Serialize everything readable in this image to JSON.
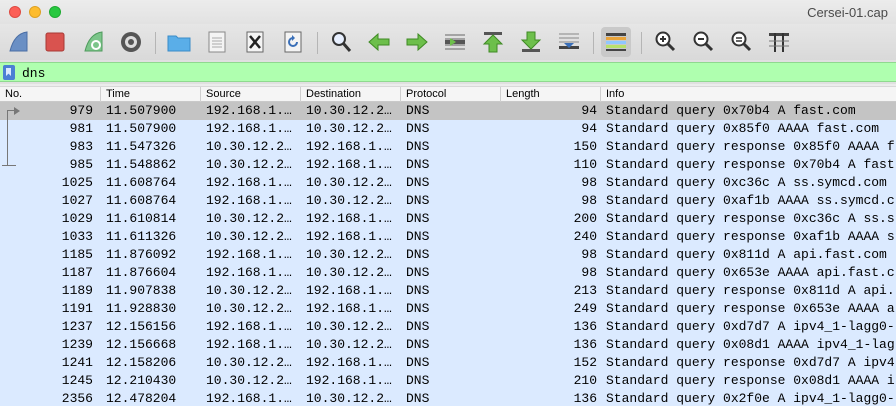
{
  "window": {
    "title": "Cersei-01.cap"
  },
  "toolbar": {
    "buttons": [
      {
        "name": "start-capture-icon"
      },
      {
        "name": "stop-capture-icon"
      },
      {
        "name": "restart-capture-icon"
      },
      {
        "name": "capture-options-icon"
      },
      {
        "name": "open-file-icon"
      },
      {
        "name": "save-file-icon"
      },
      {
        "name": "close-file-icon"
      },
      {
        "name": "reload-file-icon"
      },
      {
        "name": "find-packet-icon"
      },
      {
        "name": "go-back-icon"
      },
      {
        "name": "go-forward-icon"
      },
      {
        "name": "go-to-packet-icon"
      },
      {
        "name": "go-first-packet-icon"
      },
      {
        "name": "go-last-packet-icon"
      },
      {
        "name": "autoscroll-icon"
      },
      {
        "name": "colorize-icon"
      },
      {
        "name": "zoom-in-icon"
      },
      {
        "name": "zoom-out-icon"
      },
      {
        "name": "normal-size-icon"
      },
      {
        "name": "resize-columns-icon"
      }
    ]
  },
  "filter": {
    "value": "dns"
  },
  "columns": {
    "no": "No.",
    "time": "Time",
    "source": "Source",
    "destination": "Destination",
    "protocol": "Protocol",
    "length": "Length",
    "info": "Info"
  },
  "colors": {
    "filter_valid": "#afffaf",
    "row_udp": "#dbeaff",
    "row_selected": "#c4c4c4"
  },
  "packets": [
    {
      "no": "979",
      "time": "11.507900",
      "src": "192.168.1.…",
      "dst": "10.30.12.2…",
      "proto": "DNS",
      "len": "94",
      "info": "Standard query 0x70b4 A fast.com"
    },
    {
      "no": "981",
      "time": "11.507900",
      "src": "192.168.1.…",
      "dst": "10.30.12.2…",
      "proto": "DNS",
      "len": "94",
      "info": "Standard query 0x85f0 AAAA fast.com"
    },
    {
      "no": "983",
      "time": "11.547326",
      "src": "10.30.12.2…",
      "dst": "192.168.1.…",
      "proto": "DNS",
      "len": "150",
      "info": "Standard query response 0x85f0 AAAA f"
    },
    {
      "no": "985",
      "time": "11.548862",
      "src": "10.30.12.2…",
      "dst": "192.168.1.…",
      "proto": "DNS",
      "len": "110",
      "info": "Standard query response 0x70b4 A fast"
    },
    {
      "no": "1025",
      "time": "11.608764",
      "src": "192.168.1.…",
      "dst": "10.30.12.2…",
      "proto": "DNS",
      "len": "98",
      "info": "Standard query 0xc36c A ss.symcd.com"
    },
    {
      "no": "1027",
      "time": "11.608764",
      "src": "192.168.1.…",
      "dst": "10.30.12.2…",
      "proto": "DNS",
      "len": "98",
      "info": "Standard query 0xaf1b AAAA ss.symcd.c"
    },
    {
      "no": "1029",
      "time": "11.610814",
      "src": "10.30.12.2…",
      "dst": "192.168.1.…",
      "proto": "DNS",
      "len": "200",
      "info": "Standard query response 0xc36c A ss.s"
    },
    {
      "no": "1033",
      "time": "11.611326",
      "src": "10.30.12.2…",
      "dst": "192.168.1.…",
      "proto": "DNS",
      "len": "240",
      "info": "Standard query response 0xaf1b AAAA s"
    },
    {
      "no": "1185",
      "time": "11.876092",
      "src": "192.168.1.…",
      "dst": "10.30.12.2…",
      "proto": "DNS",
      "len": "98",
      "info": "Standard query 0x811d A api.fast.com"
    },
    {
      "no": "1187",
      "time": "11.876604",
      "src": "192.168.1.…",
      "dst": "10.30.12.2…",
      "proto": "DNS",
      "len": "98",
      "info": "Standard query 0x653e AAAA api.fast.c"
    },
    {
      "no": "1189",
      "time": "11.907838",
      "src": "10.30.12.2…",
      "dst": "192.168.1.…",
      "proto": "DNS",
      "len": "213",
      "info": "Standard query response 0x811d A api."
    },
    {
      "no": "1191",
      "time": "11.928830",
      "src": "10.30.12.2…",
      "dst": "192.168.1.…",
      "proto": "DNS",
      "len": "249",
      "info": "Standard query response 0x653e AAAA a"
    },
    {
      "no": "1237",
      "time": "12.156156",
      "src": "192.168.1.…",
      "dst": "10.30.12.2…",
      "proto": "DNS",
      "len": "136",
      "info": "Standard query 0xd7d7 A ipv4_1-lagg0-"
    },
    {
      "no": "1239",
      "time": "12.156668",
      "src": "192.168.1.…",
      "dst": "10.30.12.2…",
      "proto": "DNS",
      "len": "136",
      "info": "Standard query 0x08d1 AAAA ipv4_1-lag"
    },
    {
      "no": "1241",
      "time": "12.158206",
      "src": "10.30.12.2…",
      "dst": "192.168.1.…",
      "proto": "DNS",
      "len": "152",
      "info": "Standard query response 0xd7d7 A ipv4"
    },
    {
      "no": "1245",
      "time": "12.210430",
      "src": "10.30.12.2…",
      "dst": "192.168.1.…",
      "proto": "DNS",
      "len": "210",
      "info": "Standard query response 0x08d1 AAAA i"
    },
    {
      "no": "2356",
      "time": "12.478204",
      "src": "192.168.1.…",
      "dst": "10.30.12.2…",
      "proto": "DNS",
      "len": "136",
      "info": "Standard query 0x2f0e A ipv4_1-lagg0-"
    }
  ]
}
